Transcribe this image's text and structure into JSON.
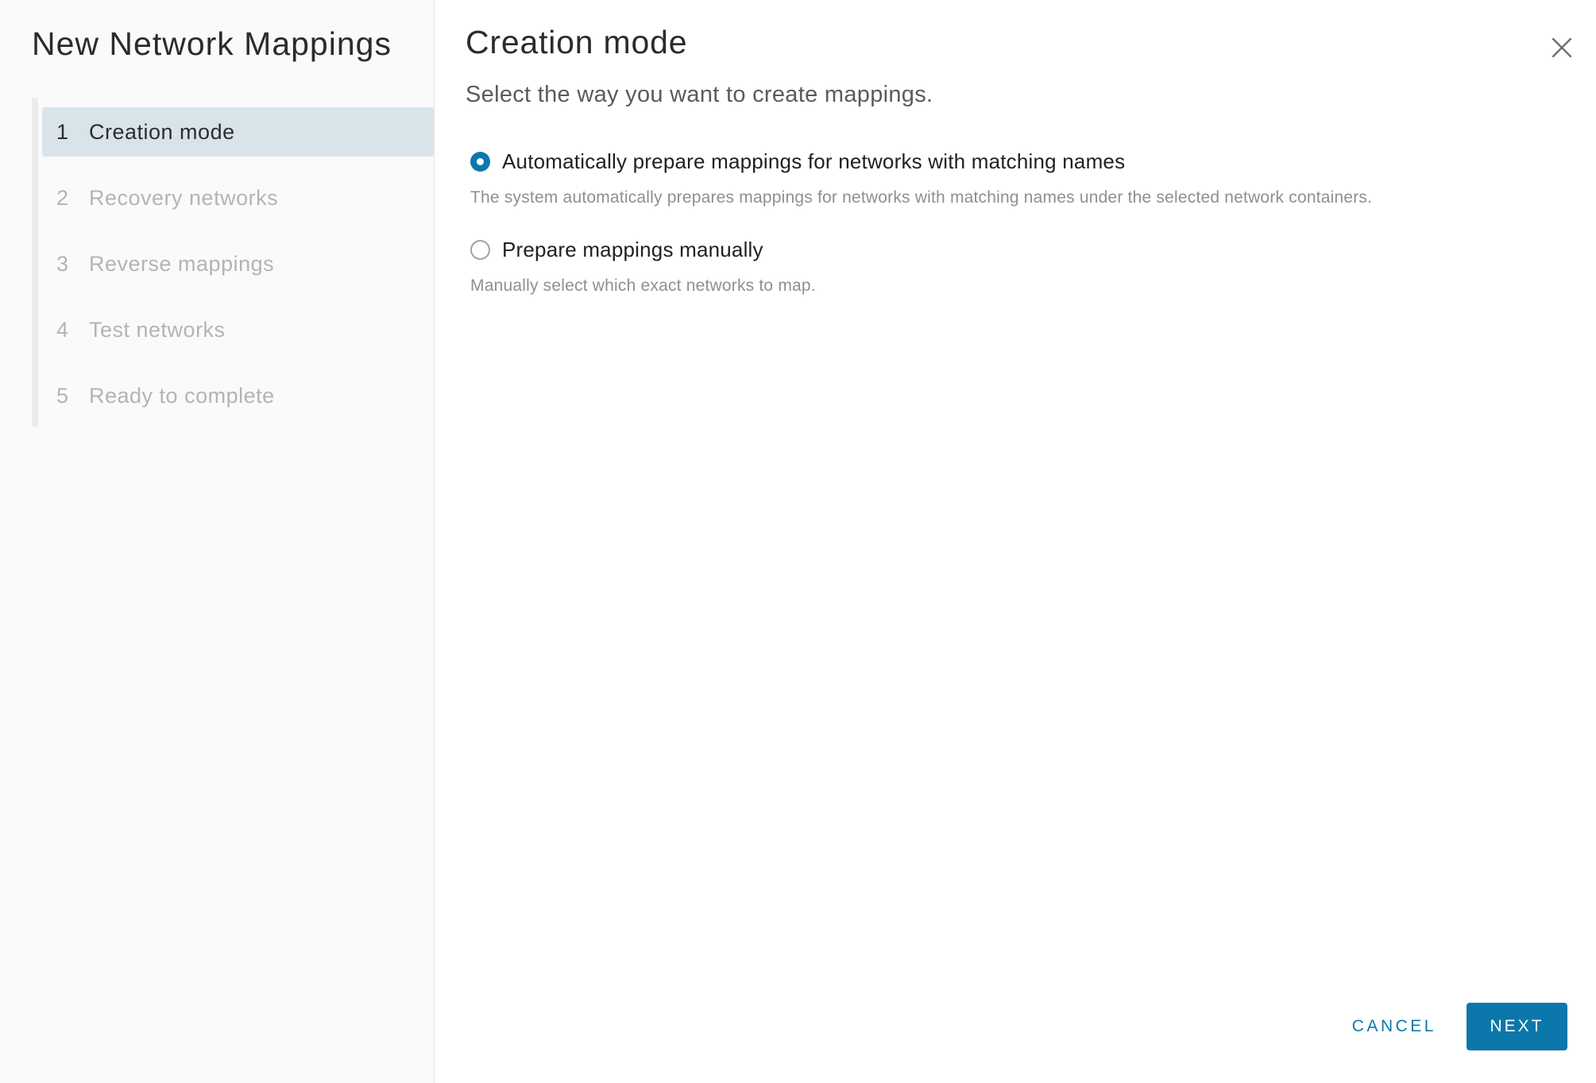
{
  "dialog": {
    "title": "New Network Mappings"
  },
  "icons": {
    "close": "x-mark"
  },
  "steps": [
    {
      "number": "1",
      "label": "Creation mode",
      "active": true
    },
    {
      "number": "2",
      "label": "Recovery networks",
      "active": false
    },
    {
      "number": "3",
      "label": "Reverse mappings",
      "active": false
    },
    {
      "number": "4",
      "label": "Test networks",
      "active": false
    },
    {
      "number": "5",
      "label": "Ready to complete",
      "active": false
    }
  ],
  "content": {
    "heading": "Creation mode",
    "subtitle": "Select the way you want to create mappings.",
    "options": [
      {
        "label": "Automatically prepare mappings for networks with matching names",
        "description": "The system automatically prepares mappings for networks with matching names under the selected network containers.",
        "selected": true
      },
      {
        "label": "Prepare mappings manually",
        "description": "Manually select which exact networks to map.",
        "selected": false
      }
    ]
  },
  "footer": {
    "cancel_label": "CANCEL",
    "next_label": "NEXT"
  },
  "colors": {
    "accent": "#0c77aa",
    "active_step_bg": "#d8e3ea",
    "sidebar_bg": "#fafafa",
    "radio_selected": "#0b79ae"
  }
}
